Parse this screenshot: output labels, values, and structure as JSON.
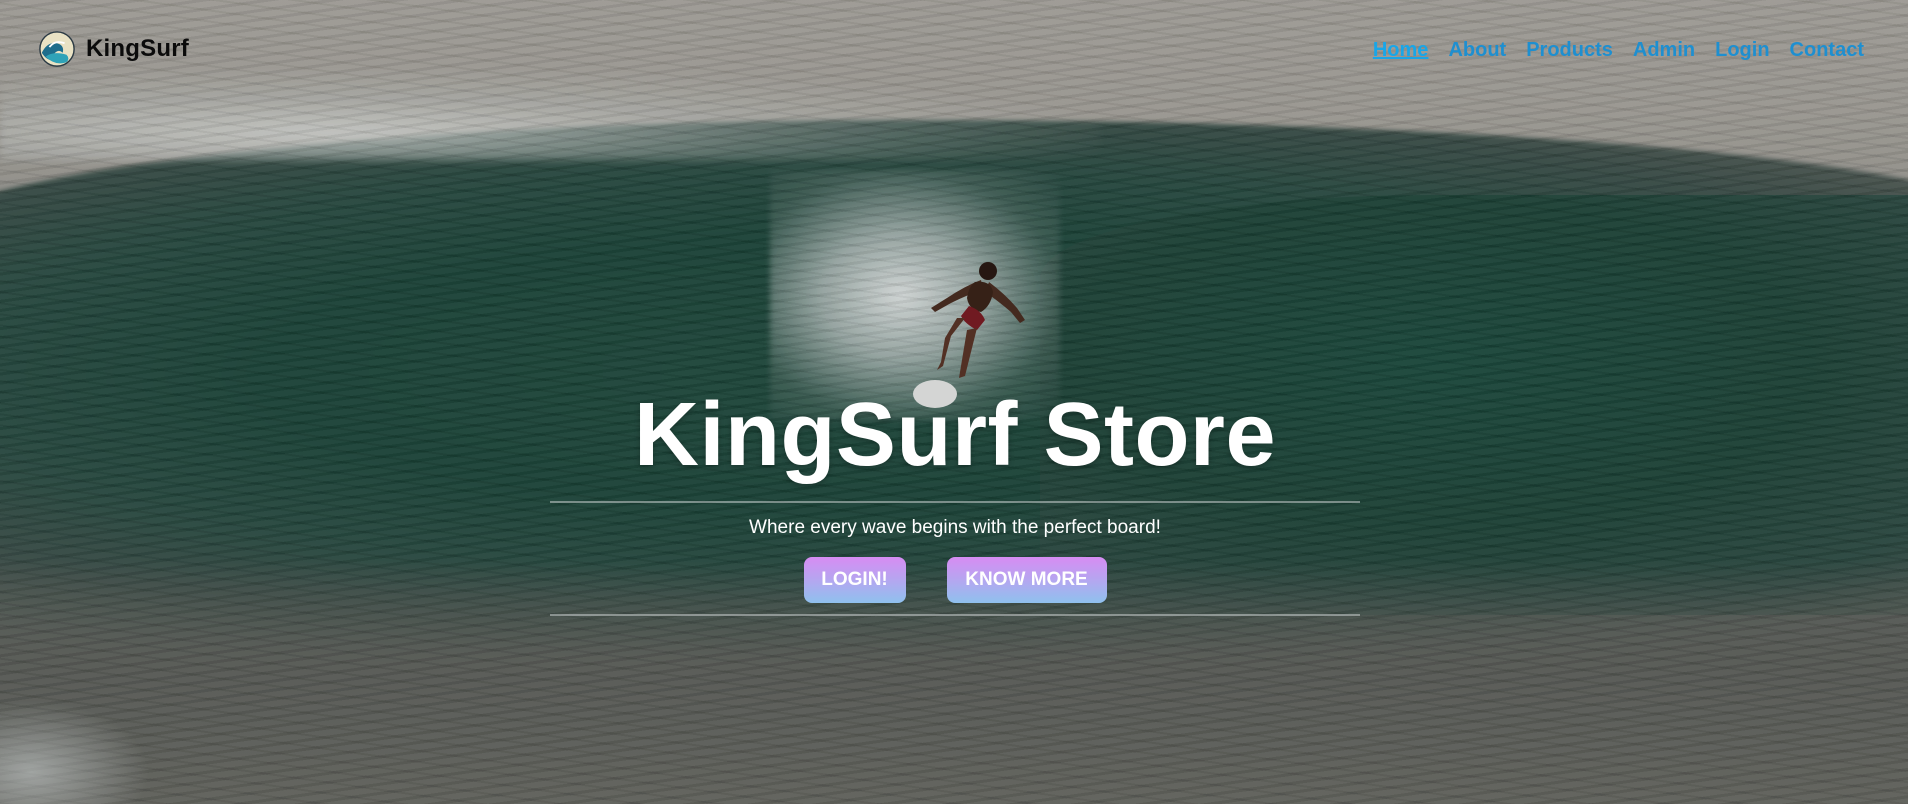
{
  "brand": {
    "name": "KingSurf",
    "logo_icon": "wave-logo-icon"
  },
  "nav": {
    "items": [
      {
        "label": "Home",
        "active": true
      },
      {
        "label": "About",
        "active": false
      },
      {
        "label": "Products",
        "active": false
      },
      {
        "label": "Admin",
        "active": false
      },
      {
        "label": "Login",
        "active": false
      },
      {
        "label": "Contact",
        "active": false
      }
    ]
  },
  "hero": {
    "title": "KingSurf Store",
    "subtitle": "Where every wave begins with the perfect board!",
    "login_button": "LOGIN!",
    "know_more_button": "KNOW MORE"
  },
  "colors": {
    "nav_link": "#1e8fd0",
    "nav_active": "#19a6e8",
    "button_gradient_top": "#d78cf3",
    "button_gradient_bottom": "#8fc1ee",
    "hero_text": "#ffffff"
  }
}
